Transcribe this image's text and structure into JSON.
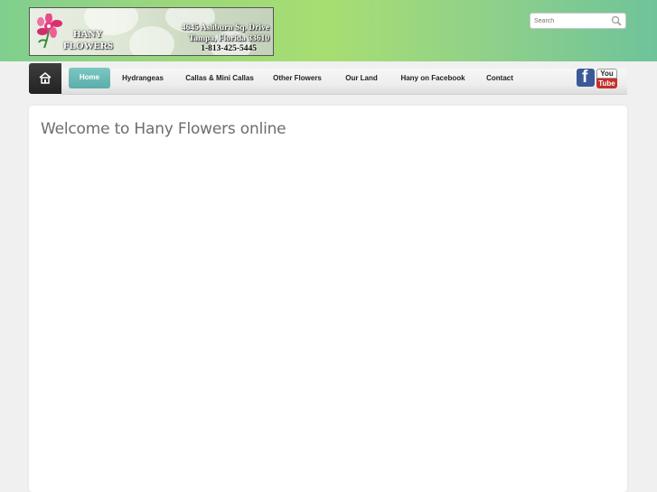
{
  "logo": {
    "brand_line1": "HANY",
    "brand_line2": "FLOWERS",
    "address_line1": "4645 Ashburn Sq. Drive",
    "address_line2": "Tampa, Florida 33610",
    "phone": "1-813-425-5445"
  },
  "search": {
    "placeholder": "Search",
    "icon": "magnifier-icon"
  },
  "nav": {
    "home_icon": "home-icon",
    "items": [
      {
        "label": "Home",
        "active": true
      },
      {
        "label": "Hydrangeas",
        "active": false
      },
      {
        "label": "Callas & Mini Callas",
        "active": false
      },
      {
        "label": "Other Flowers",
        "active": false
      },
      {
        "label": "Our Land",
        "active": false
      },
      {
        "label": "Hany on Facebook",
        "active": false
      },
      {
        "label": "Contact",
        "active": false
      }
    ],
    "facebook_glyph": "f",
    "youtube_top": "You",
    "youtube_bottom": "Tube"
  },
  "main": {
    "title": "Welcome to Hany Flowers online"
  },
  "colors": {
    "accent": "#62b3ae",
    "header_green": "#a7de72",
    "facebook": "#3b5998",
    "youtube_red": "#c4302b"
  }
}
